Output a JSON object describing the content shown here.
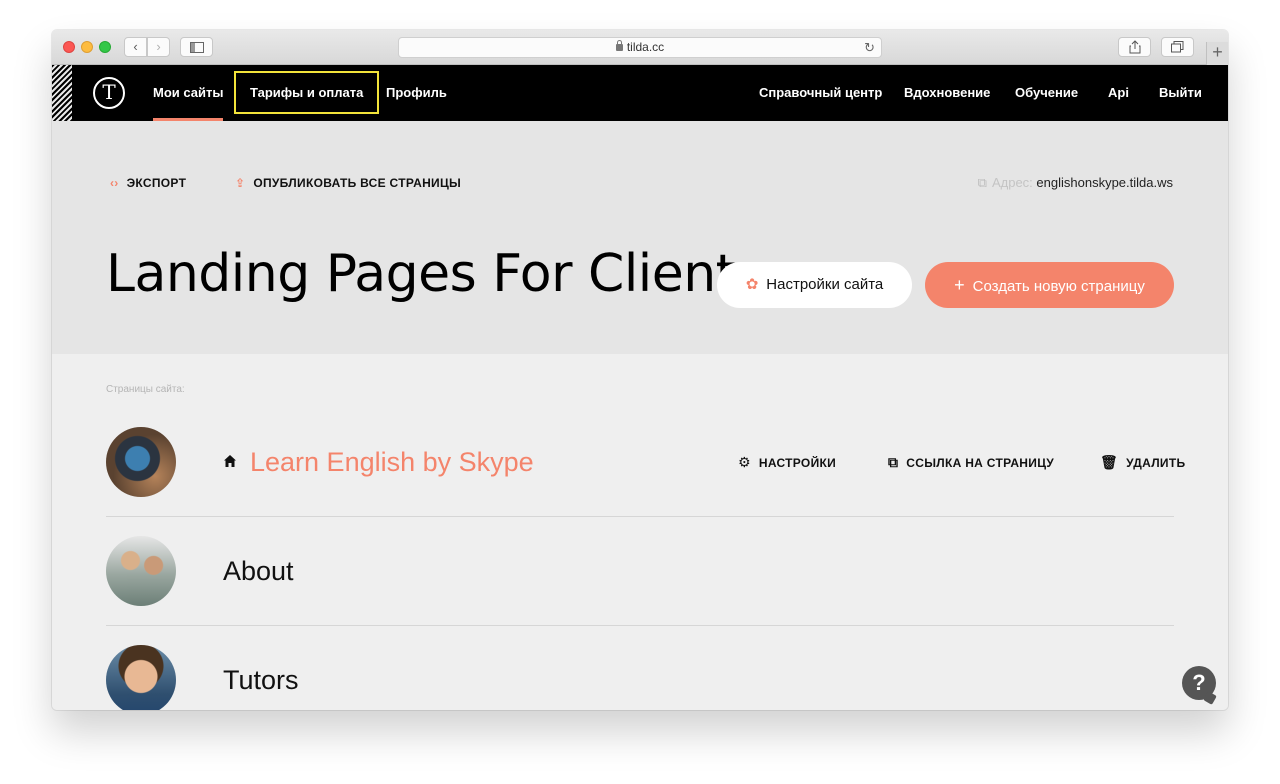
{
  "browser": {
    "url": "tilda.cc",
    "back_glyph": "‹",
    "forward_glyph": "›",
    "reload_glyph": "↻",
    "new_tab_glyph": "+"
  },
  "nav": {
    "logo": "T",
    "left": [
      "Мои сайты",
      "Тарифы и оплата",
      "Профиль"
    ],
    "right": [
      "Справочный центр",
      "Вдохновение",
      "Обучение",
      "Api",
      "Выйти"
    ],
    "active_color": "#f4846b",
    "highlight_color": "#f2e33a"
  },
  "toolbar": {
    "export_icon": "‹›",
    "export_label": "ЭКСПОРТ",
    "publish_icon": "⇪",
    "publish_label": "ОПУБЛИКОВАТЬ ВСЕ СТРАНИЦЫ",
    "address_icon": "⧉",
    "address_label": "Адрес:",
    "address_value": "englishonskype.tilda.ws"
  },
  "site": {
    "title": "Landing Pages For Client",
    "settings_icon": "✿",
    "settings_label": "Настройки сайта",
    "create_icon": "+",
    "create_label": "Создать новую страницу"
  },
  "pages": {
    "caption": "Страницы сайта:",
    "items": [
      {
        "name": "Learn English by Skype",
        "is_home": true
      },
      {
        "name": "About",
        "is_home": false
      },
      {
        "name": "Tutors",
        "is_home": false
      }
    ],
    "actions": {
      "settings_icon": "⚙",
      "settings_label": "НАСТРОЙКИ",
      "link_icon": "⧉",
      "link_label": "ССЫЛКА НА СТРАНИЦУ",
      "delete_icon": "🗑",
      "delete_label": "УДАЛИТЬ"
    }
  },
  "help": {
    "label": "?"
  },
  "colors": {
    "accent": "#f4846b",
    "nav_bg": "#000000",
    "hero_bg": "#e5e5e5",
    "list_bg": "#efefef"
  }
}
